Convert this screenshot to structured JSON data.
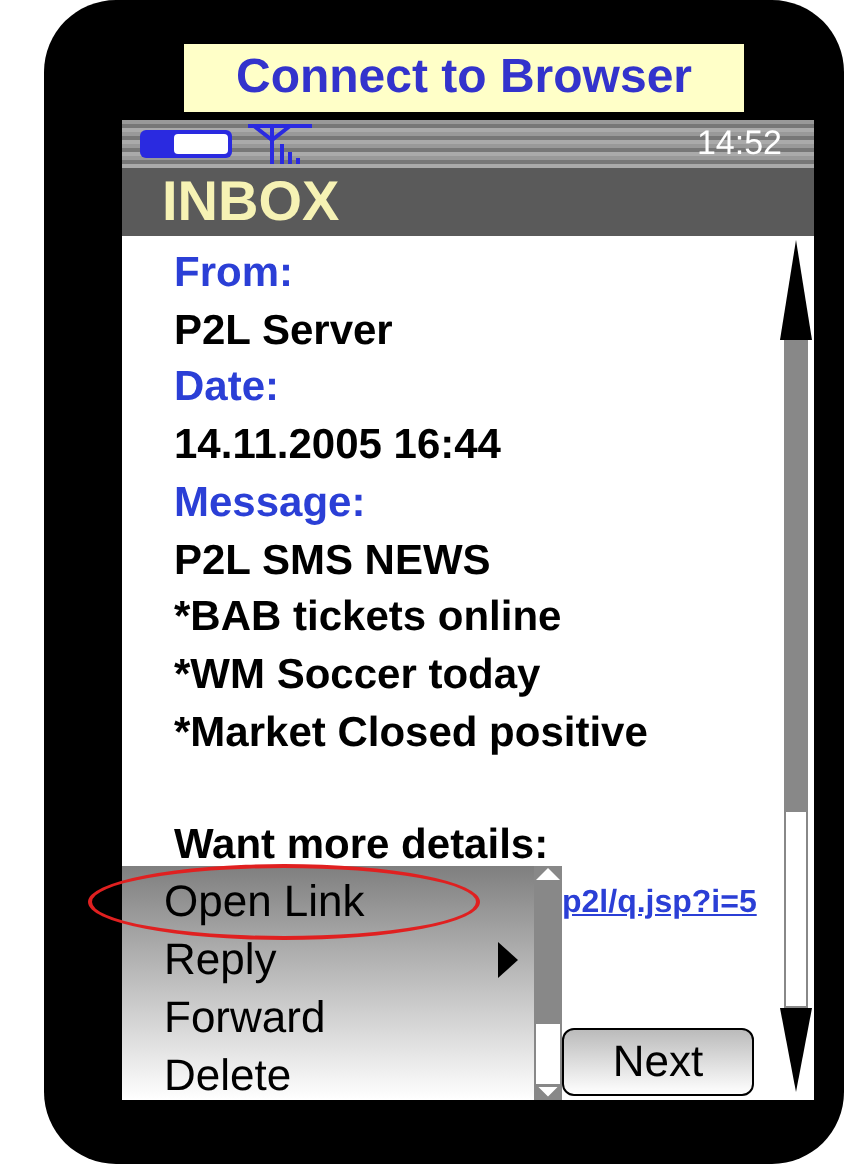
{
  "tooltip": {
    "text": "Connect to Browser"
  },
  "status_bar": {
    "time": "14:52"
  },
  "header": {
    "title": "INBOX"
  },
  "message": {
    "lines": [
      {
        "kind": "label",
        "text": "From:"
      },
      {
        "kind": "value",
        "text": "P2L Server"
      },
      {
        "kind": "label",
        "text": "Date:"
      },
      {
        "kind": "value",
        "text": "14.11.2005 16:44"
      },
      {
        "kind": "label",
        "text": "Message:"
      },
      {
        "kind": "value",
        "text": "P2L SMS NEWS"
      },
      {
        "kind": "value",
        "text": "*BAB tickets online"
      },
      {
        "kind": "value",
        "text": "*WM Soccer today"
      },
      {
        "kind": "value",
        "text": "*Market Closed positive"
      }
    ],
    "prompt": "Want more details:",
    "link": "p2l/q.jsp?i=5"
  },
  "menu": {
    "items": [
      {
        "label": "Open Link",
        "highlighted": true,
        "submenu": false
      },
      {
        "label": "Reply",
        "highlighted": false,
        "submenu": true
      },
      {
        "label": "Forward",
        "highlighted": false,
        "submenu": false
      },
      {
        "label": "Delete",
        "highlighted": false,
        "submenu": false
      }
    ]
  },
  "softkey": {
    "label": "Next"
  }
}
